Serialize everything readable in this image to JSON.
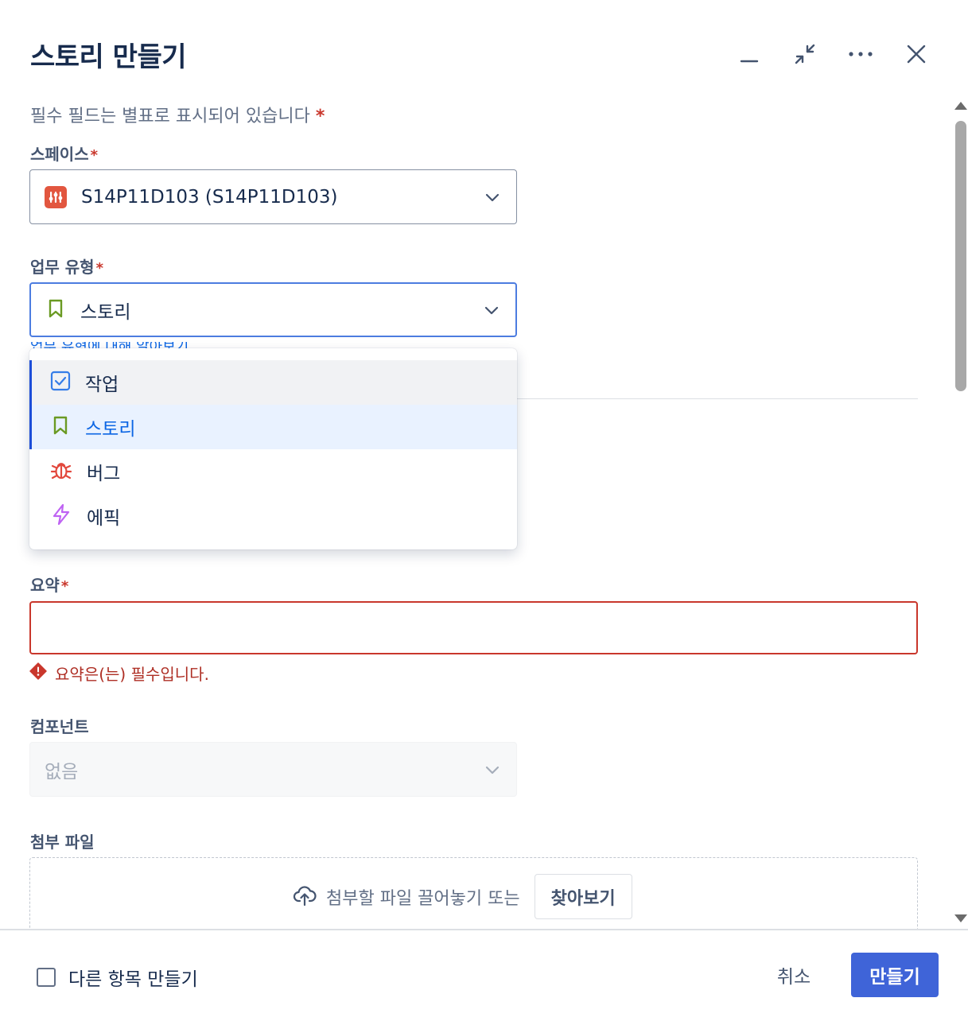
{
  "header": {
    "title": "스토리 만들기"
  },
  "form": {
    "required_note": "필수 필드는 별표로 표시되어 있습니다",
    "required_mark": "*",
    "space": {
      "label": "스페이스",
      "value": "S14P11D103 (S14P11D103)",
      "icon": "space-avatar-icon"
    },
    "work_type": {
      "label": "업무 유형",
      "value": "스토리",
      "helper_link": "업무 유형에 대해 알아보기",
      "options": [
        {
          "label": "작업",
          "icon": "task-checkbox-icon",
          "color": "#357de8",
          "state": "hover"
        },
        {
          "label": "스토리",
          "icon": "story-bookmark-icon",
          "color": "#6a9a23",
          "state": "selected"
        },
        {
          "label": "버그",
          "icon": "bug-icon",
          "color": "#e2483d",
          "state": ""
        },
        {
          "label": "에픽",
          "icon": "epic-lightning-icon",
          "color": "#bf63f3",
          "state": ""
        }
      ]
    },
    "summary": {
      "label": "요약",
      "value": "",
      "error": "요약은(는) 필수입니다."
    },
    "component": {
      "label": "컴포넌트",
      "value": "없음"
    },
    "attachment": {
      "label": "첨부 파일",
      "drop_text": "첨부할 파일 끌어놓기 또는",
      "browse_label": "찾아보기"
    }
  },
  "footer": {
    "create_another_label": "다른 항목 만들기",
    "create_another_checked": false,
    "cancel_label": "취소",
    "create_label": "만들기"
  },
  "colors": {
    "primary": "#3f64d8",
    "error": "#c9372c",
    "focus": "#4c7ce0"
  }
}
